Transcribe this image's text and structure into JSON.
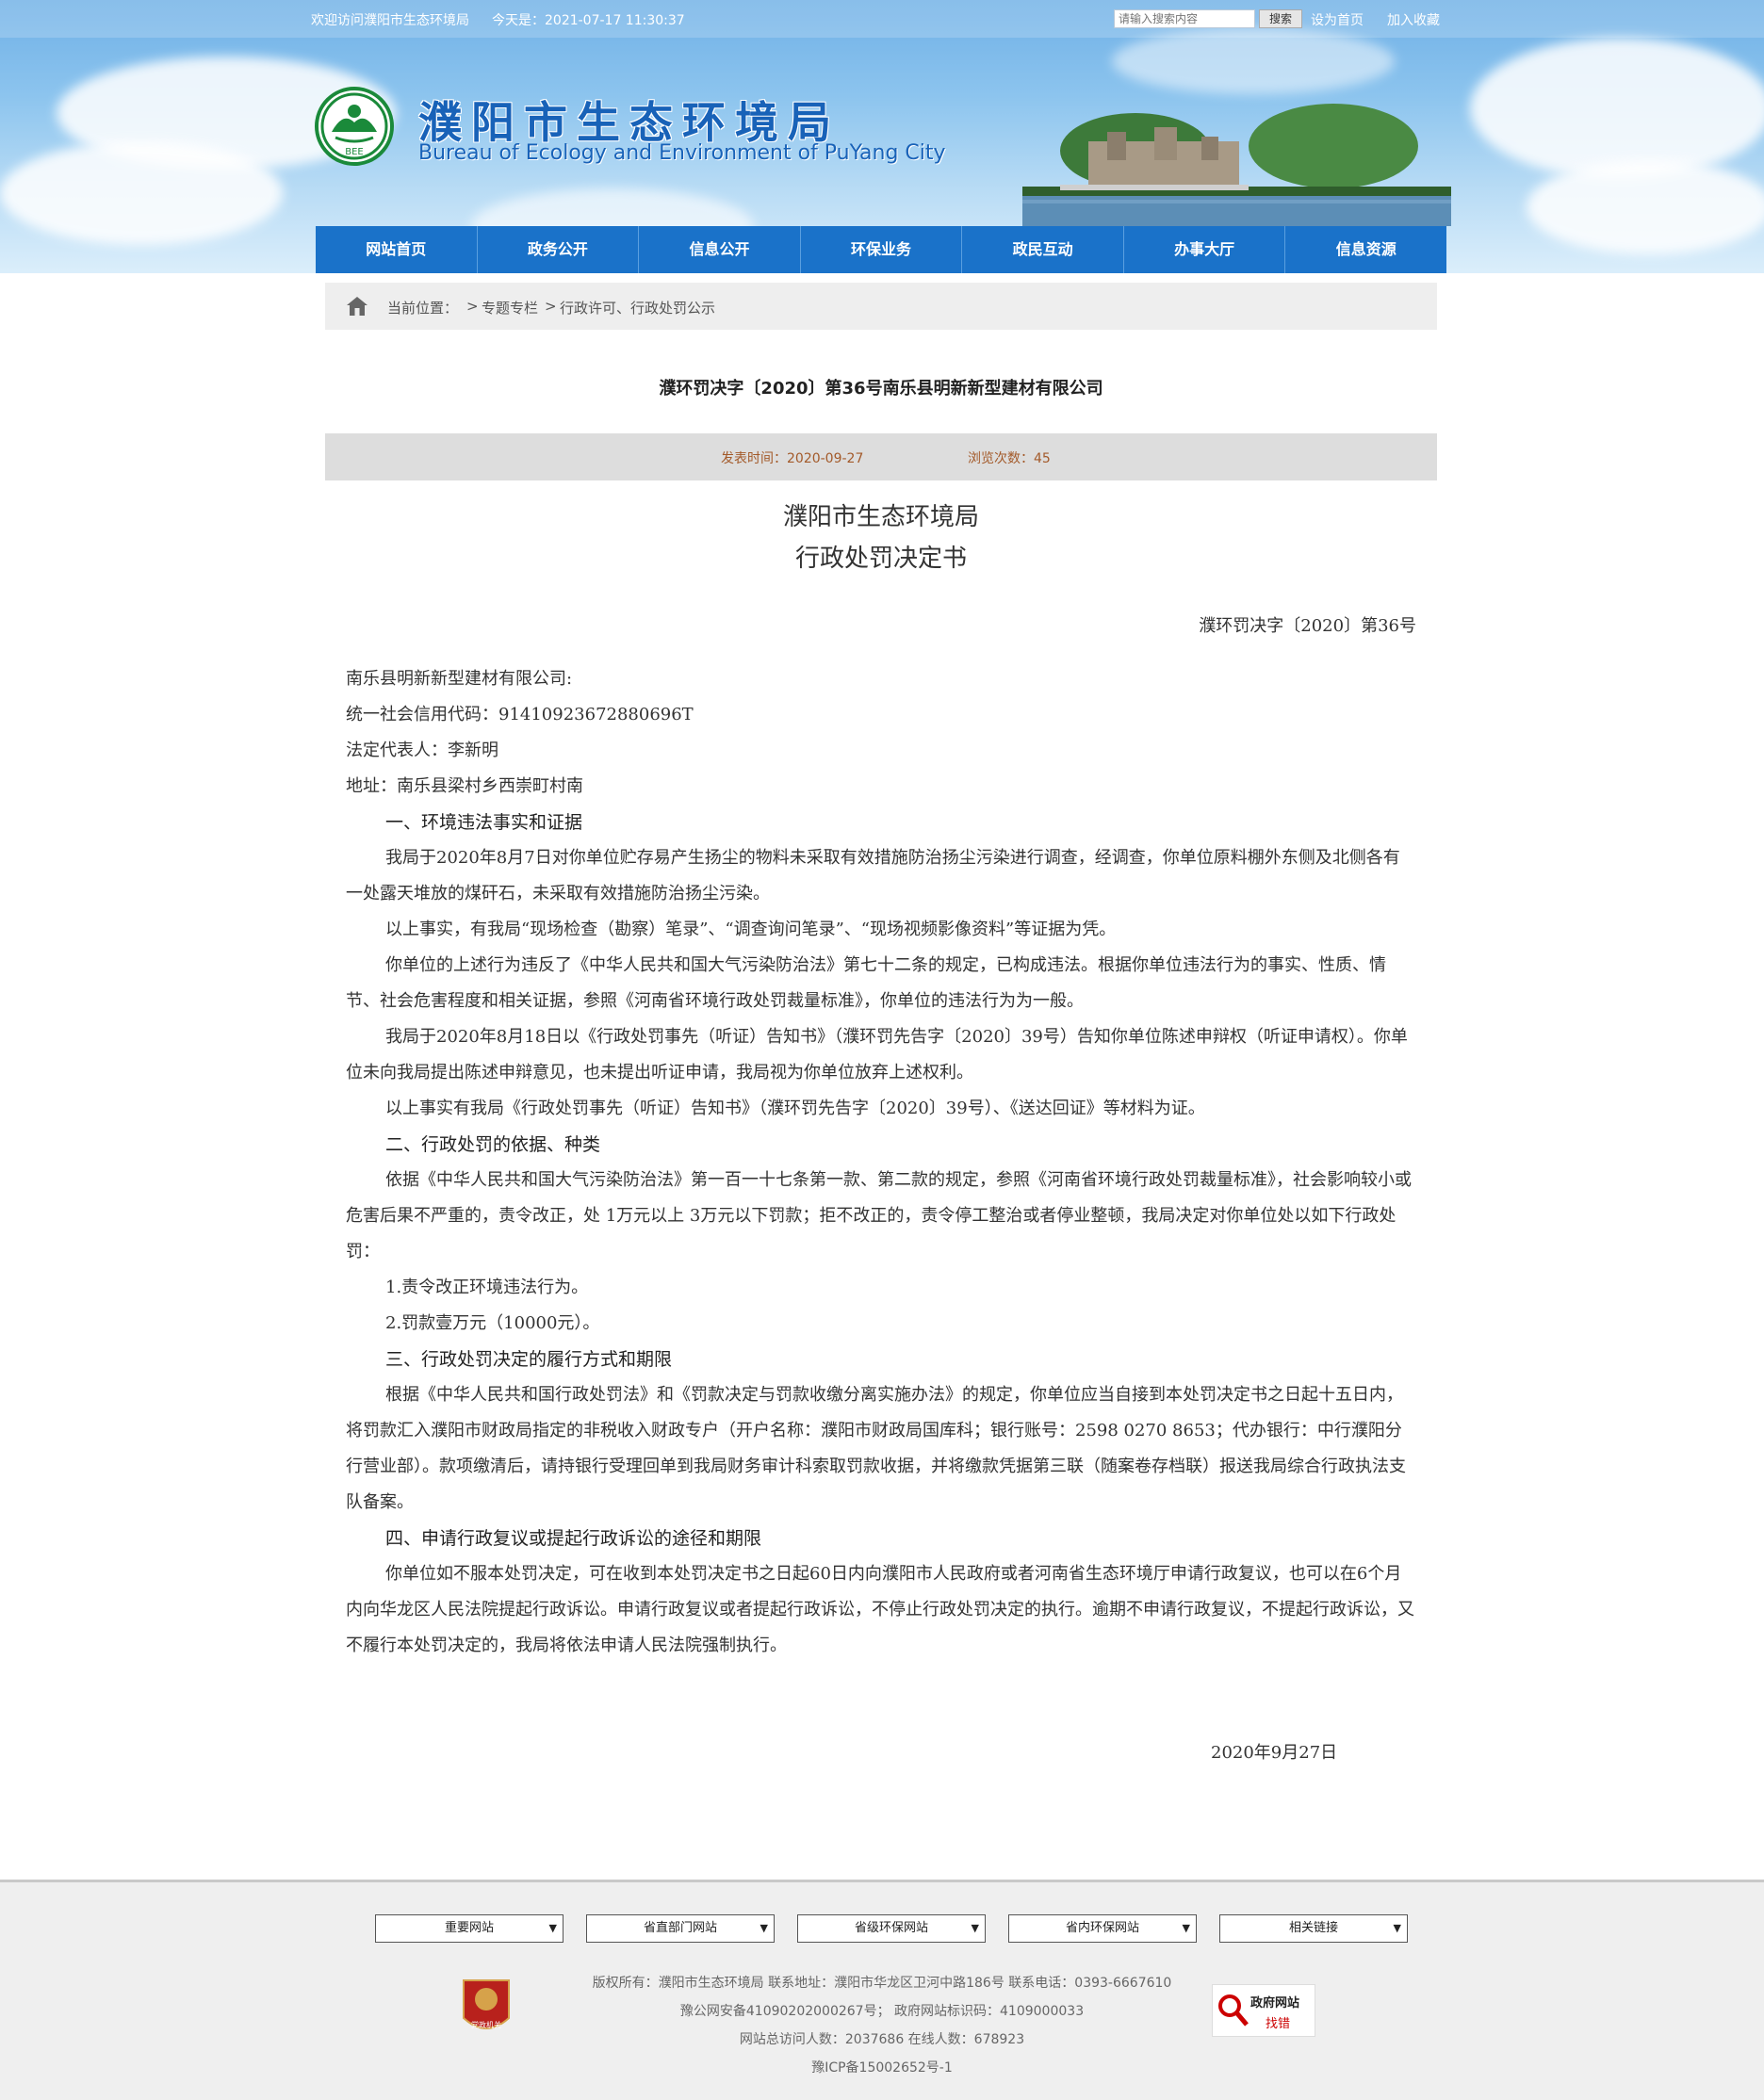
{
  "topbar": {
    "welcome": "欢迎访问濮阳市生态环境局",
    "today_label": "今天是：",
    "today_value": "2021-07-17 11:30:37",
    "search_placeholder": "请输入搜索内容",
    "search_button": "搜索",
    "set_home": "设为首页",
    "add_favorite": "加入收藏"
  },
  "header": {
    "title_cn": "濮阳市生态环境局",
    "title_en": "Bureau of Ecology and Environment of PuYang City",
    "emblem_text": "BEE"
  },
  "nav": {
    "items": [
      "网站首页",
      "政务公开",
      "信息公开",
      "环保业务",
      "政民互动",
      "办事大厅",
      "信息资源"
    ]
  },
  "breadcrumb": {
    "label": "当前位置：",
    "sep": ">",
    "items": [
      "专题专栏",
      "行政许可、行政处罚公示"
    ]
  },
  "article": {
    "title": "濮环罚决字〔2020〕第36号南乐县明新新型建材有限公司",
    "publish_label": "发表时间：",
    "publish_date": "2020-09-27",
    "views_label": "浏览次数：",
    "views": "45",
    "org": "濮阳市生态环境局",
    "doc_type": "行政处罚决定书",
    "doc_number": "濮环罚决字〔2020〕第36号",
    "paragraphs": [
      {
        "kind": "plain",
        "text": "南乐县明新新型建材有限公司:"
      },
      {
        "kind": "plain",
        "text": "统一社会信用代码：91410923672880696T"
      },
      {
        "kind": "plain",
        "text": "法定代表人：李新明"
      },
      {
        "kind": "plain",
        "text": "地址：南乐县梁村乡西崇町村南"
      },
      {
        "kind": "heading",
        "text": "一、环境违法事实和证据"
      },
      {
        "kind": "indent",
        "text": "我局于2020年8月7日对你单位贮存易产生扬尘的物料未采取有效措施防治扬尘污染进行调查，经调查，你单位原料棚外东侧及北侧各有一处露天堆放的煤矸石，未采取有效措施防治扬尘污染。"
      },
      {
        "kind": "indent",
        "text": "以上事实，有我局“现场检查（勘察）笔录”、“调查询问笔录”、“现场视频影像资料”等证据为凭。"
      },
      {
        "kind": "indent",
        "text": "你单位的上述行为违反了《中华人民共和国大气污染防治法》第七十二条的规定，已构成违法。根据你单位违法行为的事实、性质、情节、社会危害程度和相关证据，参照《河南省环境行政处罚裁量标准》，你单位的违法行为为一般。"
      },
      {
        "kind": "indent",
        "text": "我局于2020年8月18日以《行政处罚事先（听证）告知书》（濮环罚先告字〔2020〕39号）告知你单位陈述申辩权（听证申请权）。你单位未向我局提出陈述申辩意见，也未提出听证申请，我局视为你单位放弃上述权利。"
      },
      {
        "kind": "indent",
        "text": "以上事实有我局《行政处罚事先（听证）告知书》（濮环罚先告字〔2020〕39号）、《送达回证》等材料为证。"
      },
      {
        "kind": "heading",
        "text": "二、行政处罚的依据、种类"
      },
      {
        "kind": "indent",
        "text": "依据《中华人民共和国大气污染防治法》第一百一十七条第一款、第二款的规定，参照《河南省环境行政处罚裁量标准》，社会影响较小或危害后果不严重的，责令改正，处 1万元以上 3万元以下罚款；拒不改正的，责令停工整治或者停业整顿，我局决定对你单位处以如下行政处罚："
      },
      {
        "kind": "indent",
        "text": "1.责令改正环境违法行为。"
      },
      {
        "kind": "indent",
        "text": "2.罚款壹万元（10000元）。"
      },
      {
        "kind": "heading",
        "text": "三、行政处罚决定的履行方式和期限"
      },
      {
        "kind": "indent",
        "text": "根据《中华人民共和国行政处罚法》和《罚款决定与罚款收缴分离实施办法》的规定，你单位应当自接到本处罚决定书之日起十五日内，将罚款汇入濮阳市财政局指定的非税收入财政专户（开户名称：濮阳市财政局国库科；银行账号：2598 0270 8653；代办银行：中行濮阳分行营业部）。款项缴清后，请持银行受理回单到我局财务审计科索取罚款收据，并将缴款凭据第三联（随案卷存档联）报送我局综合行政执法支队备案。"
      },
      {
        "kind": "heading",
        "text": "四、申请行政复议或提起行政诉讼的途径和期限"
      },
      {
        "kind": "indent",
        "text": "你单位如不服本处罚决定，可在收到本处罚决定书之日起60日内向濮阳市人民政府或者河南省生态环境厅申请行政复议，也可以在6个月内向华龙区人民法院提起行政诉讼。申请行政复议或者提起行政诉讼，不停止行政处罚决定的执行。逾期不申请行政复议，不提起行政诉讼，又不履行本处罚决定的，我局将依法申请人民法院强制执行。"
      }
    ],
    "sign_date": "2020年9月27日"
  },
  "footer": {
    "selects": [
      "重要网站",
      "省直部门网站",
      "省级环保网站",
      "省内环保网站",
      "相关链接"
    ],
    "copyright": "版权所有：濮阳市生态环境局  联系地址：濮阳市华龙区卫河中路186号  联系电话：0393-6667610",
    "police": "豫公网安备41090202000267号；  政府网站标识码：4109000033",
    "visits": "网站总访问人数：2037686  在线人数：678923",
    "icp": "豫ICP备15002652号-1",
    "badge_left_text": "党政机关",
    "badge_right_text1": "政府网站",
    "badge_right_text2": "找错"
  },
  "colors": {
    "nav_blue": "#1a72c9",
    "title_blue": "#1862b8",
    "meta_brown": "#a35a2a",
    "emblem_green": "#1a8a3a"
  }
}
